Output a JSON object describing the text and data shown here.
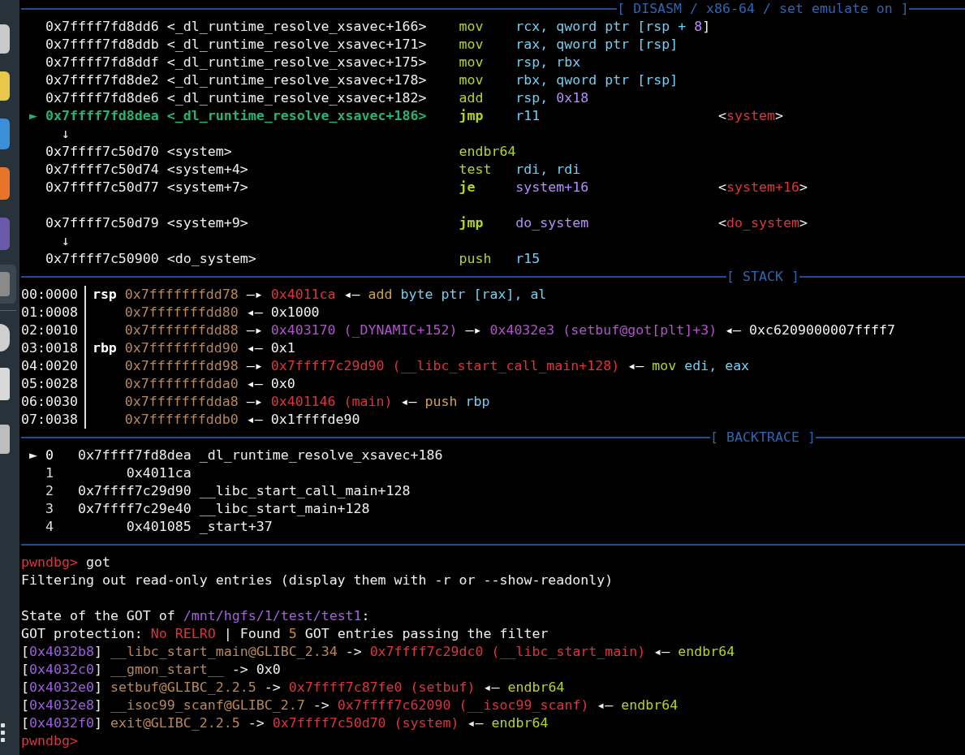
{
  "disasm": {
    "title": "[ DISASM / x86-64 / set emulate on ]",
    "pointer": "►",
    "rows": [
      {
        "kind": "insn",
        "selected": false,
        "address": "0x7ffff7fd8dd6",
        "symbol": "<_dl_runtime_resolve_xsavec+166>",
        "mnemonic": "mov",
        "bold": false,
        "operands": [
          {
            "text": "rcx, qword ptr [rsp + ",
            "kind": "reg"
          },
          {
            "text": "8",
            "kind": "num"
          },
          {
            "text": "]",
            "kind": "plain"
          }
        ]
      },
      {
        "kind": "insn",
        "selected": false,
        "address": "0x7ffff7fd8ddb",
        "symbol": "<_dl_runtime_resolve_xsavec+171>",
        "mnemonic": "mov",
        "bold": false,
        "operands": [
          {
            "text": "rax, qword ptr [rsp]",
            "kind": "reg"
          }
        ]
      },
      {
        "kind": "insn",
        "selected": false,
        "address": "0x7ffff7fd8ddf",
        "symbol": "<_dl_runtime_resolve_xsavec+175>",
        "mnemonic": "mov",
        "bold": false,
        "operands": [
          {
            "text": "rsp, rbx",
            "kind": "reg"
          }
        ]
      },
      {
        "kind": "insn",
        "selected": false,
        "address": "0x7ffff7fd8de2",
        "symbol": "<_dl_runtime_resolve_xsavec+178>",
        "mnemonic": "mov",
        "bold": false,
        "operands": [
          {
            "text": "rbx, qword ptr [rsp]",
            "kind": "reg"
          }
        ]
      },
      {
        "kind": "insn",
        "selected": false,
        "address": "0x7ffff7fd8de6",
        "symbol": "<_dl_runtime_resolve_xsavec+182>",
        "mnemonic": "add",
        "bold": false,
        "operands": [
          {
            "text": "rsp, ",
            "kind": "reg"
          },
          {
            "text": "0x18",
            "kind": "num"
          }
        ]
      },
      {
        "kind": "insn",
        "selected": true,
        "address": "0x7ffff7fd8dea",
        "symbol": "<_dl_runtime_resolve_xsavec+186>",
        "mnemonic": "jmp",
        "bold": true,
        "operands": [
          {
            "text": "r11",
            "kind": "reg"
          }
        ],
        "comment": [
          {
            "text": "<",
            "kind": "plain"
          },
          {
            "text": "system",
            "kind": "code"
          },
          {
            "text": ">",
            "kind": "plain"
          }
        ]
      },
      {
        "kind": "branch",
        "text": "↓"
      },
      {
        "kind": "insn",
        "selected": false,
        "address": "0x7ffff7c50d70",
        "symbol": "<system>",
        "mnemonic": "endbr64",
        "bold": false
      },
      {
        "kind": "insn",
        "selected": false,
        "address": "0x7ffff7c50d74",
        "symbol": "<system+4>",
        "mnemonic": "test",
        "bold": false,
        "operands": [
          {
            "text": "rdi, rdi",
            "kind": "reg"
          }
        ]
      },
      {
        "kind": "insn",
        "selected": false,
        "address": "0x7ffff7c50d77",
        "symbol": "<system+7>",
        "mnemonic": "je",
        "bold": true,
        "operands": [
          {
            "text": "system+16",
            "kind": "num"
          }
        ],
        "comment": [
          {
            "text": "<",
            "kind": "plain"
          },
          {
            "text": "system+16",
            "kind": "code"
          },
          {
            "text": ">",
            "kind": "plain"
          }
        ]
      },
      {
        "kind": "gap"
      },
      {
        "kind": "insn",
        "selected": false,
        "address": "0x7ffff7c50d79",
        "symbol": "<system+9>",
        "mnemonic": "jmp",
        "bold": true,
        "operands": [
          {
            "text": "do_system",
            "kind": "num"
          }
        ],
        "comment": [
          {
            "text": "<",
            "kind": "plain"
          },
          {
            "text": "do_system",
            "kind": "code"
          },
          {
            "text": ">",
            "kind": "plain"
          }
        ]
      },
      {
        "kind": "branch",
        "text": "↓"
      },
      {
        "kind": "insn",
        "selected": false,
        "address": "0x7ffff7c50900",
        "symbol": "<do_system>",
        "mnemonic": "push",
        "bold": false,
        "operands": [
          {
            "text": "r15",
            "kind": "reg"
          }
        ]
      }
    ]
  },
  "stack": {
    "title": "[ STACK ]",
    "rows": [
      {
        "offset": "00:0000",
        "register": "rsp",
        "chain": [
          {
            "text": "0x7fffffffdd78",
            "kind": "stack"
          },
          {
            "text": "—▸",
            "kind": "arrow"
          },
          {
            "text": "0x4011ca",
            "kind": "code"
          },
          {
            "text": "◂—",
            "kind": "arrow"
          },
          {
            "text": "add",
            "kind": "insn_alt"
          },
          {
            "text": "byte ptr [rax], al",
            "kind": "reg"
          }
        ]
      },
      {
        "offset": "01:0008",
        "chain": [
          {
            "text": "0x7fffffffdd80",
            "kind": "stack"
          },
          {
            "text": "◂—",
            "kind": "arrow"
          },
          {
            "text": "0x1000",
            "kind": "plain"
          }
        ]
      },
      {
        "offset": "02:0010",
        "chain": [
          {
            "text": "0x7fffffffdd88",
            "kind": "stack"
          },
          {
            "text": "—▸",
            "kind": "arrow"
          },
          {
            "text": "0x403170 (_DYNAMIC+152)",
            "kind": "data"
          },
          {
            "text": "—▸",
            "kind": "arrow"
          },
          {
            "text": "0x4032e3 (setbuf@got[plt]+3)",
            "kind": "data"
          },
          {
            "text": "◂—",
            "kind": "arrow"
          },
          {
            "text": "0xc6209000007ffff7",
            "kind": "plain"
          }
        ]
      },
      {
        "offset": "03:0018",
        "register": "rbp",
        "chain": [
          {
            "text": "0x7fffffffdd90",
            "kind": "stack"
          },
          {
            "text": "◂—",
            "kind": "arrow"
          },
          {
            "text": "0x1",
            "kind": "plain"
          }
        ]
      },
      {
        "offset": "04:0020",
        "chain": [
          {
            "text": "0x7fffffffdd98",
            "kind": "stack"
          },
          {
            "text": "—▸",
            "kind": "arrow"
          },
          {
            "text": "0x7ffff7c29d90 (__libc_start_call_main+128)",
            "kind": "code"
          },
          {
            "text": "◂—",
            "kind": "arrow"
          },
          {
            "text": "mov",
            "kind": "mnem"
          },
          {
            "text": "edi, eax",
            "kind": "reg"
          }
        ]
      },
      {
        "offset": "05:0028",
        "chain": [
          {
            "text": "0x7fffffffdda0",
            "kind": "stack"
          },
          {
            "text": "◂—",
            "kind": "arrow"
          },
          {
            "text": "0x0",
            "kind": "plain"
          }
        ]
      },
      {
        "offset": "06:0030",
        "chain": [
          {
            "text": "0x7fffffffdda8",
            "kind": "stack"
          },
          {
            "text": "—▸",
            "kind": "arrow"
          },
          {
            "text": "0x401146 (main)",
            "kind": "code"
          },
          {
            "text": "◂—",
            "kind": "arrow"
          },
          {
            "text": "push",
            "kind": "insn_alt"
          },
          {
            "text": "rbp",
            "kind": "reg"
          }
        ]
      },
      {
        "offset": "07:0038",
        "chain": [
          {
            "text": "0x7fffffffddb0",
            "kind": "stack"
          },
          {
            "text": "◂—",
            "kind": "arrow"
          },
          {
            "text": "0x1ffffde90",
            "kind": "plain"
          }
        ]
      }
    ]
  },
  "backtrace": {
    "title": "[ BACKTRACE ]",
    "pointer": "►",
    "frames": [
      {
        "selected": true,
        "index": "0",
        "address": "0x7ffff7fd8dea",
        "symbol": "_dl_runtime_resolve_xsavec+186"
      },
      {
        "selected": false,
        "index": "1",
        "address": "0x4011ca"
      },
      {
        "selected": false,
        "index": "2",
        "address": "0x7ffff7c29d90",
        "symbol": "__libc_start_call_main+128"
      },
      {
        "selected": false,
        "index": "3",
        "address": "0x7ffff7c29e40",
        "symbol": "__libc_start_main+128"
      },
      {
        "selected": false,
        "index": "4",
        "address": "0x401085",
        "symbol": "_start+37"
      }
    ]
  },
  "console": [
    {
      "kind": "prompt",
      "prompt": "pwndbg>",
      "command": "got"
    },
    {
      "kind": "output",
      "segments": [
        {
          "text": "Filtering out read-only entries (display them with -r or --show-readonly)",
          "kind": "plain"
        }
      ]
    },
    {
      "kind": "gap"
    },
    {
      "kind": "output",
      "segments": [
        {
          "text": "State of the GOT of ",
          "kind": "plain"
        },
        {
          "text": "/mnt/hgfs/1/test/test1",
          "kind": "path"
        },
        {
          "text": ":",
          "kind": "plain"
        }
      ]
    },
    {
      "kind": "output",
      "segments": [
        {
          "text": "GOT protection: ",
          "kind": "plain"
        },
        {
          "text": "No RELRO",
          "kind": "code"
        },
        {
          "text": " | Found ",
          "kind": "plain"
        },
        {
          "text": "5",
          "kind": "count"
        },
        {
          "text": " GOT entries passing the filter",
          "kind": "plain"
        }
      ]
    },
    {
      "kind": "output",
      "segments": [
        {
          "text": "[",
          "kind": "plain"
        },
        {
          "text": "0x4032b8",
          "kind": "gotaddr"
        },
        {
          "text": "] ",
          "kind": "plain"
        },
        {
          "text": "__libc_start_main@GLIBC_2.34",
          "kind": "stack"
        },
        {
          "text": " -> ",
          "kind": "plain"
        },
        {
          "text": "0x7ffff7c29dc0 (__libc_start_main)",
          "kind": "code"
        },
        {
          "text": " ◂— ",
          "kind": "plain"
        },
        {
          "text": "endbr64",
          "kind": "mnem"
        }
      ]
    },
    {
      "kind": "output",
      "segments": [
        {
          "text": "[",
          "kind": "plain"
        },
        {
          "text": "0x4032c0",
          "kind": "gotaddr"
        },
        {
          "text": "] ",
          "kind": "plain"
        },
        {
          "text": "__gmon_start__",
          "kind": "stack"
        },
        {
          "text": " -> 0x0",
          "kind": "plain"
        }
      ]
    },
    {
      "kind": "output",
      "segments": [
        {
          "text": "[",
          "kind": "plain"
        },
        {
          "text": "0x4032e0",
          "kind": "gotaddr"
        },
        {
          "text": "] ",
          "kind": "plain"
        },
        {
          "text": "setbuf@GLIBC_2.2.5",
          "kind": "stack"
        },
        {
          "text": " -> ",
          "kind": "plain"
        },
        {
          "text": "0x7ffff7c87fe0 (setbuf)",
          "kind": "code"
        },
        {
          "text": " ◂— ",
          "kind": "plain"
        },
        {
          "text": "endbr64",
          "kind": "mnem"
        }
      ]
    },
    {
      "kind": "output",
      "segments": [
        {
          "text": "[",
          "kind": "plain"
        },
        {
          "text": "0x4032e8",
          "kind": "gotaddr"
        },
        {
          "text": "] ",
          "kind": "plain"
        },
        {
          "text": "__isoc99_scanf@GLIBC_2.7",
          "kind": "stack"
        },
        {
          "text": " -> ",
          "kind": "plain"
        },
        {
          "text": "0x7ffff7c62090 (__isoc99_scanf)",
          "kind": "code"
        },
        {
          "text": " ◂— ",
          "kind": "plain"
        },
        {
          "text": "endbr64",
          "kind": "mnem"
        }
      ]
    },
    {
      "kind": "output",
      "segments": [
        {
          "text": "[",
          "kind": "plain"
        },
        {
          "text": "0x4032f0",
          "kind": "gotaddr"
        },
        {
          "text": "] ",
          "kind": "plain"
        },
        {
          "text": "exit@GLIBC_2.2.5",
          "kind": "stack"
        },
        {
          "text": " -> ",
          "kind": "plain"
        },
        {
          "text": "0x7ffff7c50d70 (system)",
          "kind": "code"
        },
        {
          "text": " ◂— ",
          "kind": "plain"
        },
        {
          "text": "endbr64",
          "kind": "mnem"
        }
      ]
    },
    {
      "kind": "prompt",
      "prompt": "pwndbg>"
    }
  ]
}
